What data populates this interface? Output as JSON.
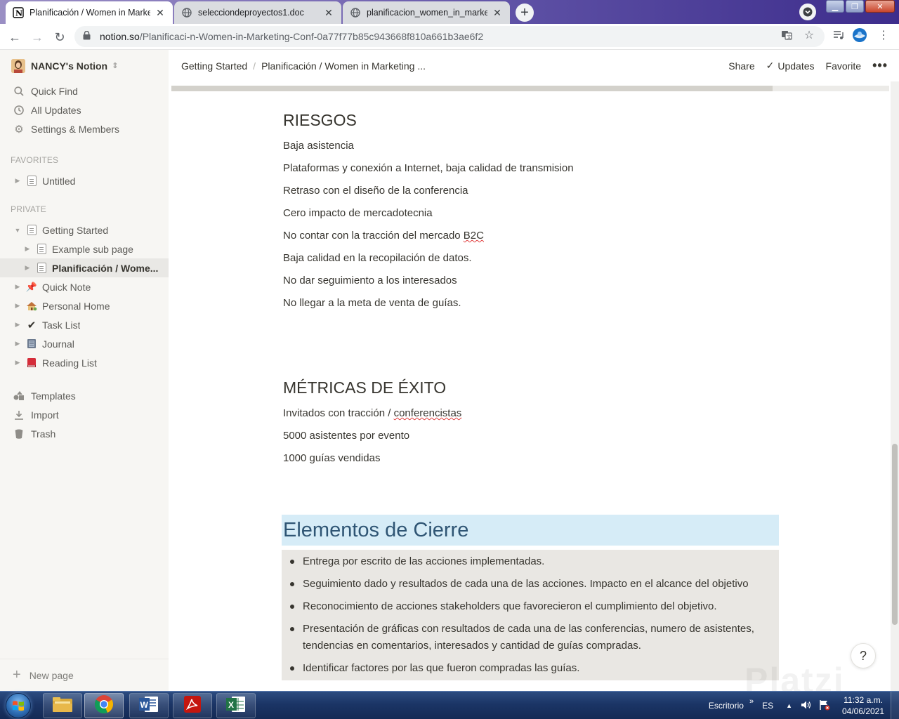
{
  "browser": {
    "tabs": [
      {
        "title": "Planificación / Women in Marketing",
        "active": true,
        "favicon": "notion-icon"
      },
      {
        "title": "selecciondeproyectos1.doc",
        "active": false,
        "favicon": "globe-icon"
      },
      {
        "title": "planificacion_women_in_marketing",
        "active": false,
        "favicon": "globe-icon"
      }
    ],
    "url_host": "notion.so",
    "url_path": "/Planificaci-n-Women-in-Marketing-Conf-0a77f77b85c943668f810a661b3ae6f2"
  },
  "sidebar": {
    "workspace": "NANCY's Notion",
    "top_items": [
      {
        "label": "Quick Find",
        "icon": "search-icon"
      },
      {
        "label": "All Updates",
        "icon": "clock-icon"
      },
      {
        "label": "Settings & Members",
        "icon": "gear-icon"
      }
    ],
    "favorites_label": "FAVORITES",
    "favorites": [
      {
        "label": "Untitled"
      }
    ],
    "private_label": "PRIVATE",
    "private": [
      {
        "label": "Getting Started"
      },
      {
        "label": "Example sub page"
      },
      {
        "label": "Planificación / Wome..."
      },
      {
        "label": "Quick Note"
      },
      {
        "label": "Personal Home"
      },
      {
        "label": "Task List"
      },
      {
        "label": "Journal"
      },
      {
        "label": "Reading List"
      }
    ],
    "bottom_items": [
      {
        "label": "Templates",
        "icon": "templates-icon"
      },
      {
        "label": "Import",
        "icon": "import-icon"
      },
      {
        "label": "Trash",
        "icon": "trash-icon"
      }
    ],
    "new_page": "New page"
  },
  "header": {
    "breadcrumb": [
      "Getting Started",
      "Planificación / Women in Marketing ..."
    ],
    "share": "Share",
    "updates": "Updates",
    "favorite": "Favorite",
    "more": "•••"
  },
  "page": {
    "riesgos_title": "RIESGOS",
    "riesgos": [
      "Baja asistencia",
      "Plataformas y conexión a Internet, baja calidad de transmision",
      "Retraso con el diseño de la conferencia",
      "Cero impacto de mercadotecnia",
      "No contar con la tracción del mercado ",
      "Baja calidad en la recopilación de datos.",
      "No dar seguimiento a los interesados",
      "No llegar a la meta de venta de guías."
    ],
    "riesgos_spell": "B2C",
    "metricas_title": "MÉTRICAS DE ÉXITO",
    "metricas_1_prefix": "Invitados con tracción / ",
    "metricas_1_spell": "conferencistas",
    "metricas_2": "5000 asistentes por evento",
    "metricas_3": "1000 guías vendidas",
    "cierre_title": "Elementos de Cierre",
    "cierre": [
      "Entrega por escrito de las acciones implementadas.",
      "Seguimiento dado y resultados de cada una de las acciones. Impacto en el alcance del objetivo",
      "Reconocimiento de acciones stakeholders que favorecieron el cumplimiento del objetivo.",
      "Presentación de gráficas con resultados de cada una de las conferencias, numero de asistentes, tendencias en comentarios, interesados y cantidad de guías compradas.",
      "Identificar factores por las que fueron compradas las guías."
    ],
    "help": "?",
    "watermark": "Platzi"
  },
  "taskbar": {
    "desktop": "Escritorio",
    "lang": "ES",
    "time": "11:32 a.m.",
    "date": "04/06/2021"
  },
  "colors": {
    "heading_bg": "#d6ecf7",
    "bullet_bg": "#e9e7e3",
    "sidebar_bg": "#f7f6f3"
  }
}
